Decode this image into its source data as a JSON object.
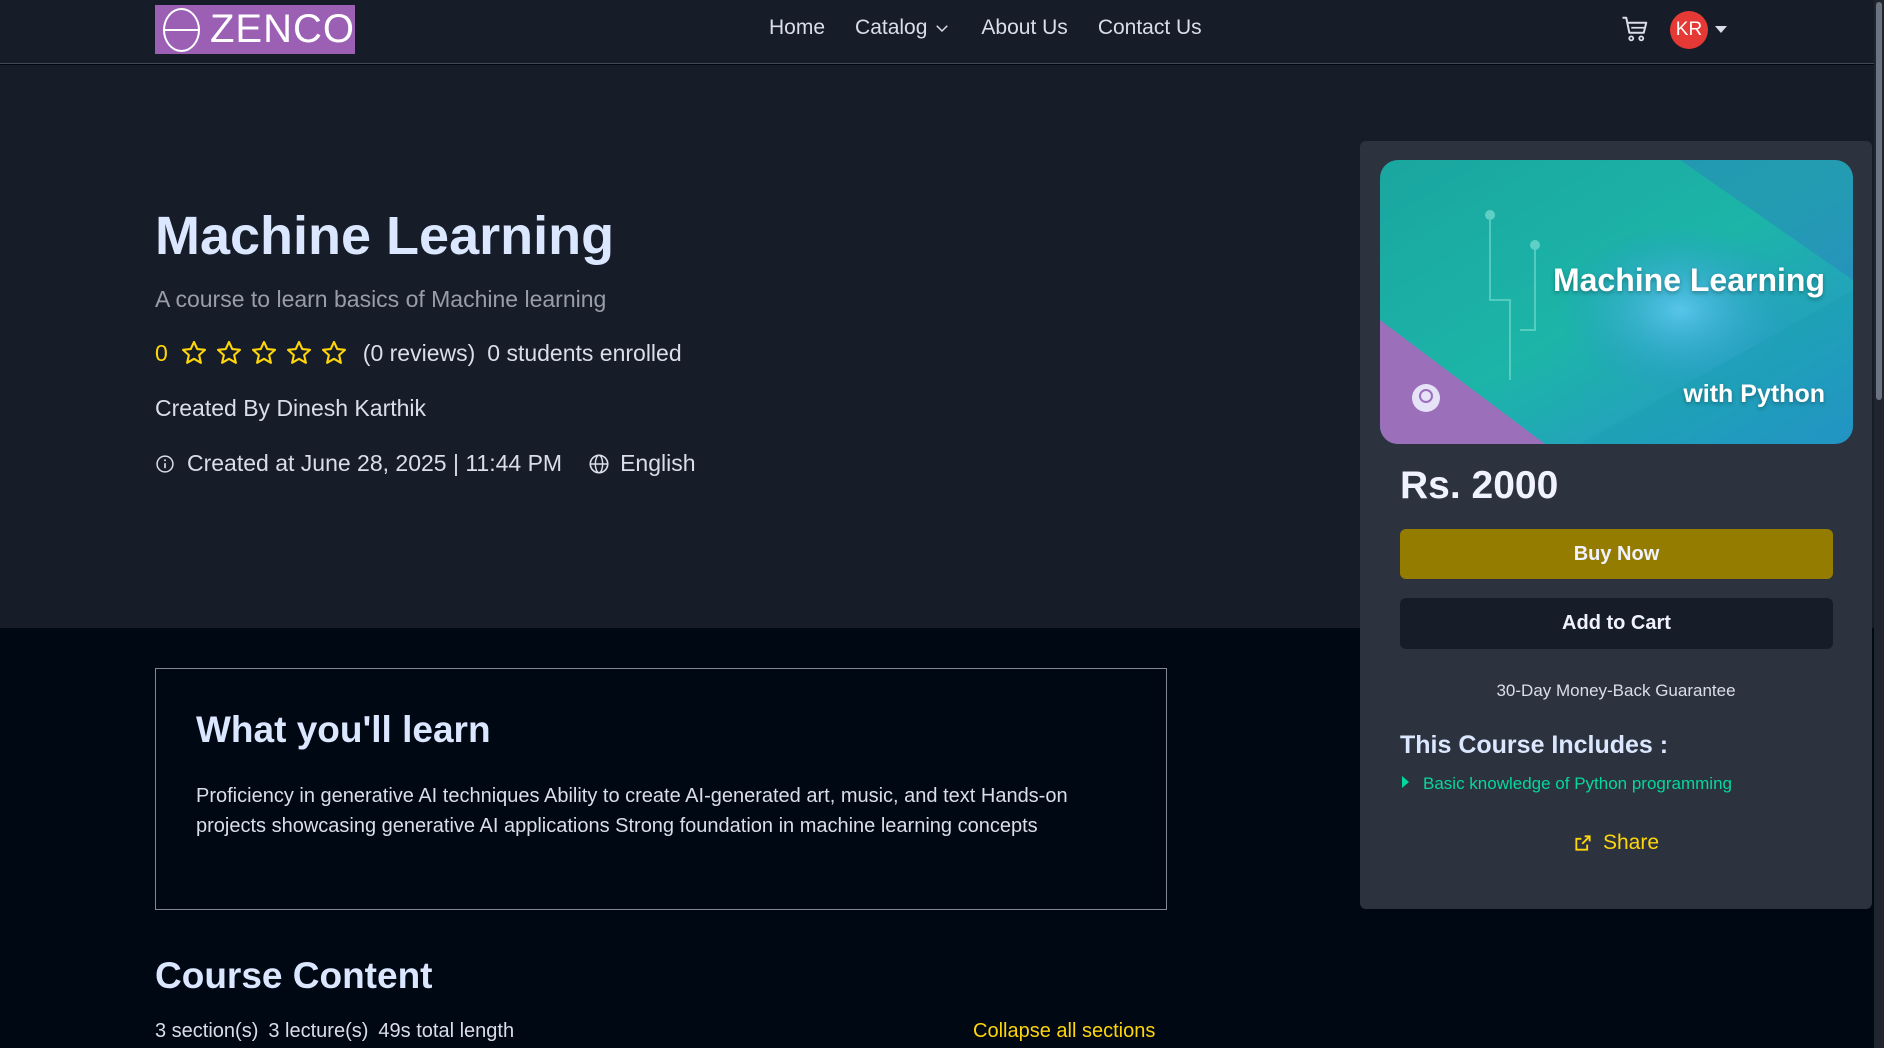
{
  "navbar": {
    "logo_text": "ZENCO",
    "links": [
      {
        "label": "Home"
      },
      {
        "label": "Catalog"
      },
      {
        "label": "About Us"
      },
      {
        "label": "Contact Us"
      }
    ],
    "avatar_initials": "KR",
    "icons": {
      "cart": "cart-icon",
      "catalog_dropdown": "chevron-down-icon",
      "avatar_menu": "caret-down-icon"
    }
  },
  "course": {
    "title": "Machine Learning",
    "description": "A course to learn basics of Machine learning",
    "rating_value": "0",
    "rating_stars": 0,
    "reviews": "(0 reviews)",
    "enrolled": "0 students enrolled",
    "created_by": "Created By Dinesh Karthik",
    "created_at": "Created at June 28, 2025 | 11:44 PM",
    "language": "English"
  },
  "card": {
    "thumbnail": {
      "line1": "Machine Learning",
      "line2": "with Python"
    },
    "price": "Rs. 2000",
    "buy_label": "Buy Now",
    "cart_label": "Add to Cart",
    "guarantee": "30-Day Money-Back Guarantee",
    "includes_title": "This Course Includes :",
    "includes": [
      {
        "label": "Basic knowledge of Python programming"
      }
    ],
    "share_label": "Share"
  },
  "learn": {
    "title": "What you'll learn",
    "text": "Proficiency in generative AI techniques Ability to create AI-generated art, music, and text Hands-on projects showcasing generative AI applications Strong foundation in machine learning concepts"
  },
  "content": {
    "title": "Course Content",
    "sections": "3 section(s)",
    "lectures": "3 lecture(s)",
    "length": "49s total length",
    "collapse_label": "Collapse all sections"
  },
  "colors": {
    "bg": "#000814",
    "hero": "#161d29",
    "card": "#2c333f",
    "accent": "#ffd60a",
    "buy": "#947c00",
    "include": "#06d6a0"
  }
}
